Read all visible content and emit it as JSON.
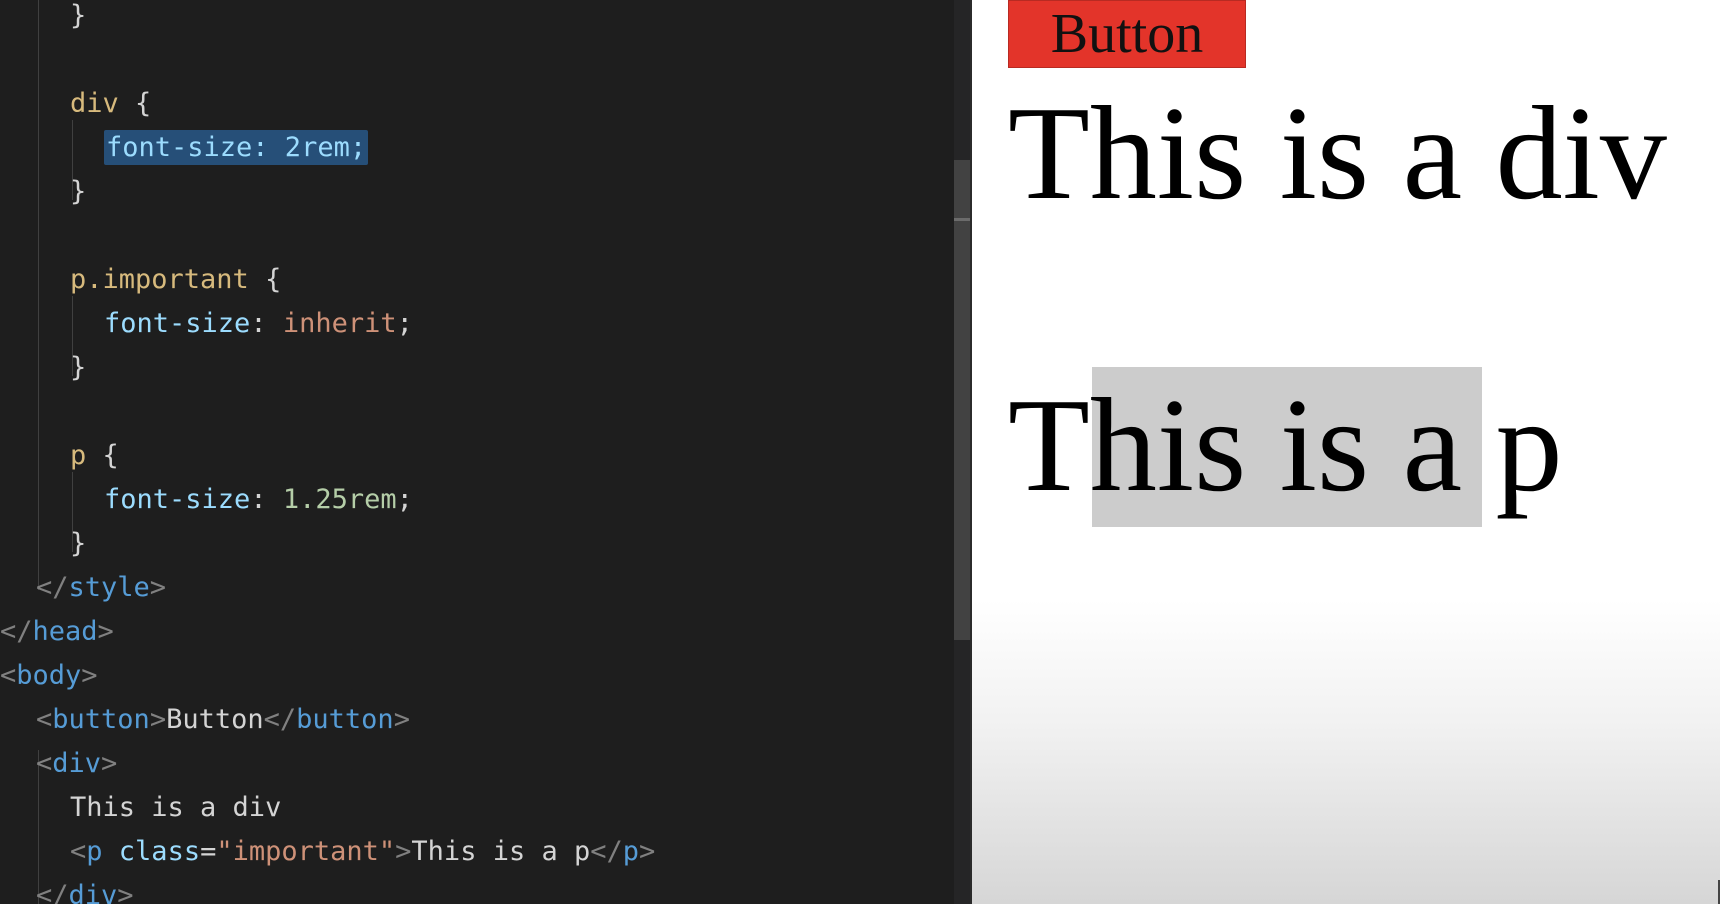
{
  "editor": {
    "lines": [
      {
        "id": "l1",
        "parts": [
          {
            "t": "}",
            "c": "punc"
          }
        ]
      },
      {
        "id": "l2",
        "parts": []
      },
      {
        "id": "l3",
        "parts": [
          {
            "t": "div",
            "c": "sel"
          },
          {
            "t": " {",
            "c": "punc"
          }
        ]
      },
      {
        "id": "l4",
        "parts": [
          {
            "t": "font-size: 2rem;",
            "c": "prop",
            "selected": true
          }
        ]
      },
      {
        "id": "l5",
        "parts": [
          {
            "t": "}",
            "c": "punc"
          }
        ]
      },
      {
        "id": "l6",
        "parts": []
      },
      {
        "id": "l7",
        "parts": [
          {
            "t": "p.important",
            "c": "sel"
          },
          {
            "t": " {",
            "c": "punc"
          }
        ]
      },
      {
        "id": "l8",
        "parts": [
          {
            "t": "font-size",
            "c": "prop"
          },
          {
            "t": ": ",
            "c": "punc"
          },
          {
            "t": "inherit",
            "c": "kw"
          },
          {
            "t": ";",
            "c": "punc"
          }
        ]
      },
      {
        "id": "l9",
        "parts": [
          {
            "t": "}",
            "c": "punc"
          }
        ]
      },
      {
        "id": "l10",
        "parts": []
      },
      {
        "id": "l11",
        "parts": [
          {
            "t": "p",
            "c": "sel"
          },
          {
            "t": " {",
            "c": "punc"
          }
        ]
      },
      {
        "id": "l12",
        "parts": [
          {
            "t": "font-size",
            "c": "prop"
          },
          {
            "t": ": ",
            "c": "punc"
          },
          {
            "t": "1.25rem",
            "c": "num"
          },
          {
            "t": ";",
            "c": "punc"
          }
        ]
      },
      {
        "id": "l13",
        "parts": [
          {
            "t": "}",
            "c": "punc"
          }
        ]
      },
      {
        "id": "l14",
        "parts": [
          {
            "t": "</",
            "c": "br"
          },
          {
            "t": "style",
            "c": "tag"
          },
          {
            "t": ">",
            "c": "br"
          }
        ]
      },
      {
        "id": "l15",
        "parts": [
          {
            "t": "</",
            "c": "br"
          },
          {
            "t": "head",
            "c": "tag"
          },
          {
            "t": ">",
            "c": "br"
          }
        ]
      },
      {
        "id": "l16",
        "parts": [
          {
            "t": "<",
            "c": "br"
          },
          {
            "t": "body",
            "c": "tag"
          },
          {
            "t": ">",
            "c": "br"
          }
        ]
      },
      {
        "id": "l17",
        "parts": [
          {
            "t": "<",
            "c": "br"
          },
          {
            "t": "button",
            "c": "tag"
          },
          {
            "t": ">",
            "c": "br"
          },
          {
            "t": "Button",
            "c": "txt"
          },
          {
            "t": "</",
            "c": "br"
          },
          {
            "t": "button",
            "c": "tag"
          },
          {
            "t": ">",
            "c": "br"
          }
        ]
      },
      {
        "id": "l18",
        "parts": [
          {
            "t": "<",
            "c": "br"
          },
          {
            "t": "div",
            "c": "tag"
          },
          {
            "t": ">",
            "c": "br"
          }
        ]
      },
      {
        "id": "l19",
        "parts": [
          {
            "t": "This is a div",
            "c": "txt"
          }
        ]
      },
      {
        "id": "l20",
        "parts": [
          {
            "t": "<",
            "c": "br"
          },
          {
            "t": "p",
            "c": "tag"
          },
          {
            "t": " ",
            "c": "txt"
          },
          {
            "t": "class",
            "c": "attr"
          },
          {
            "t": "=",
            "c": "punc"
          },
          {
            "t": "\"important\"",
            "c": "str"
          },
          {
            "t": ">",
            "c": "br"
          },
          {
            "t": "This is a p",
            "c": "txt"
          },
          {
            "t": "</",
            "c": "br"
          },
          {
            "t": "p",
            "c": "tag"
          },
          {
            "t": ">",
            "c": "br"
          }
        ]
      },
      {
        "id": "l21",
        "parts": [
          {
            "t": "</",
            "c": "br"
          },
          {
            "t": "div",
            "c": "tag"
          },
          {
            "t": ">",
            "c": "br"
          }
        ]
      }
    ]
  },
  "preview": {
    "button_label": "Button",
    "div_text": "This is a div",
    "p_text": "This is a p"
  },
  "colors": {
    "editor_bg": "#1e1e1e",
    "selection": "#264f78",
    "preview_button_bg": "#e3342a",
    "p_highlight": "#cccccc"
  }
}
